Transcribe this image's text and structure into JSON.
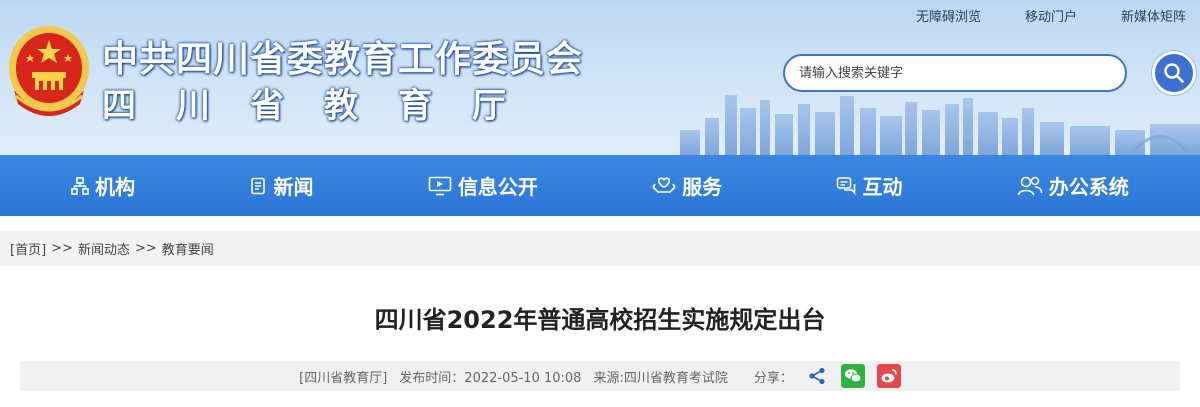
{
  "header": {
    "title_line1": "中共四川省委教育工作委员会",
    "title_line2": "四川省教育厅",
    "top_links": [
      "无障碍浏览",
      "移动门户",
      "新媒体矩阵"
    ],
    "search": {
      "placeholder": "请输入搜索关键字"
    },
    "emblem_icon": "national-emblem",
    "search_icon": "search-icon"
  },
  "nav": {
    "items": [
      {
        "label": "机构",
        "icon": "org-chart-icon"
      },
      {
        "label": "新闻",
        "icon": "document-icon"
      },
      {
        "label": "信息公开",
        "icon": "monitor-icon"
      },
      {
        "label": "服务",
        "icon": "hands-icon"
      },
      {
        "label": "互动",
        "icon": "chat-icon"
      },
      {
        "label": "办公系统",
        "icon": "users-icon"
      }
    ]
  },
  "breadcrumb": {
    "items": [
      "[首页]",
      "新闻动态",
      "教育要闻"
    ],
    "separator": ">>"
  },
  "article": {
    "title": "四川省2022年普通高校招生实施规定出台",
    "source_tag": "[四川省教育厅]",
    "publish_time": "发布时间：2022-05-10 10:08",
    "origin": "来源:四川省教育考试院",
    "share_label": "分享：",
    "share_icons": [
      "share-icon",
      "wechat-icon",
      "weibo-icon"
    ]
  },
  "colors": {
    "nav_blue": "#2f7bdb",
    "title_shadow": "#1b4c9c",
    "wechat_green": "#2bb53f",
    "weibo_red": "#e6474b"
  }
}
